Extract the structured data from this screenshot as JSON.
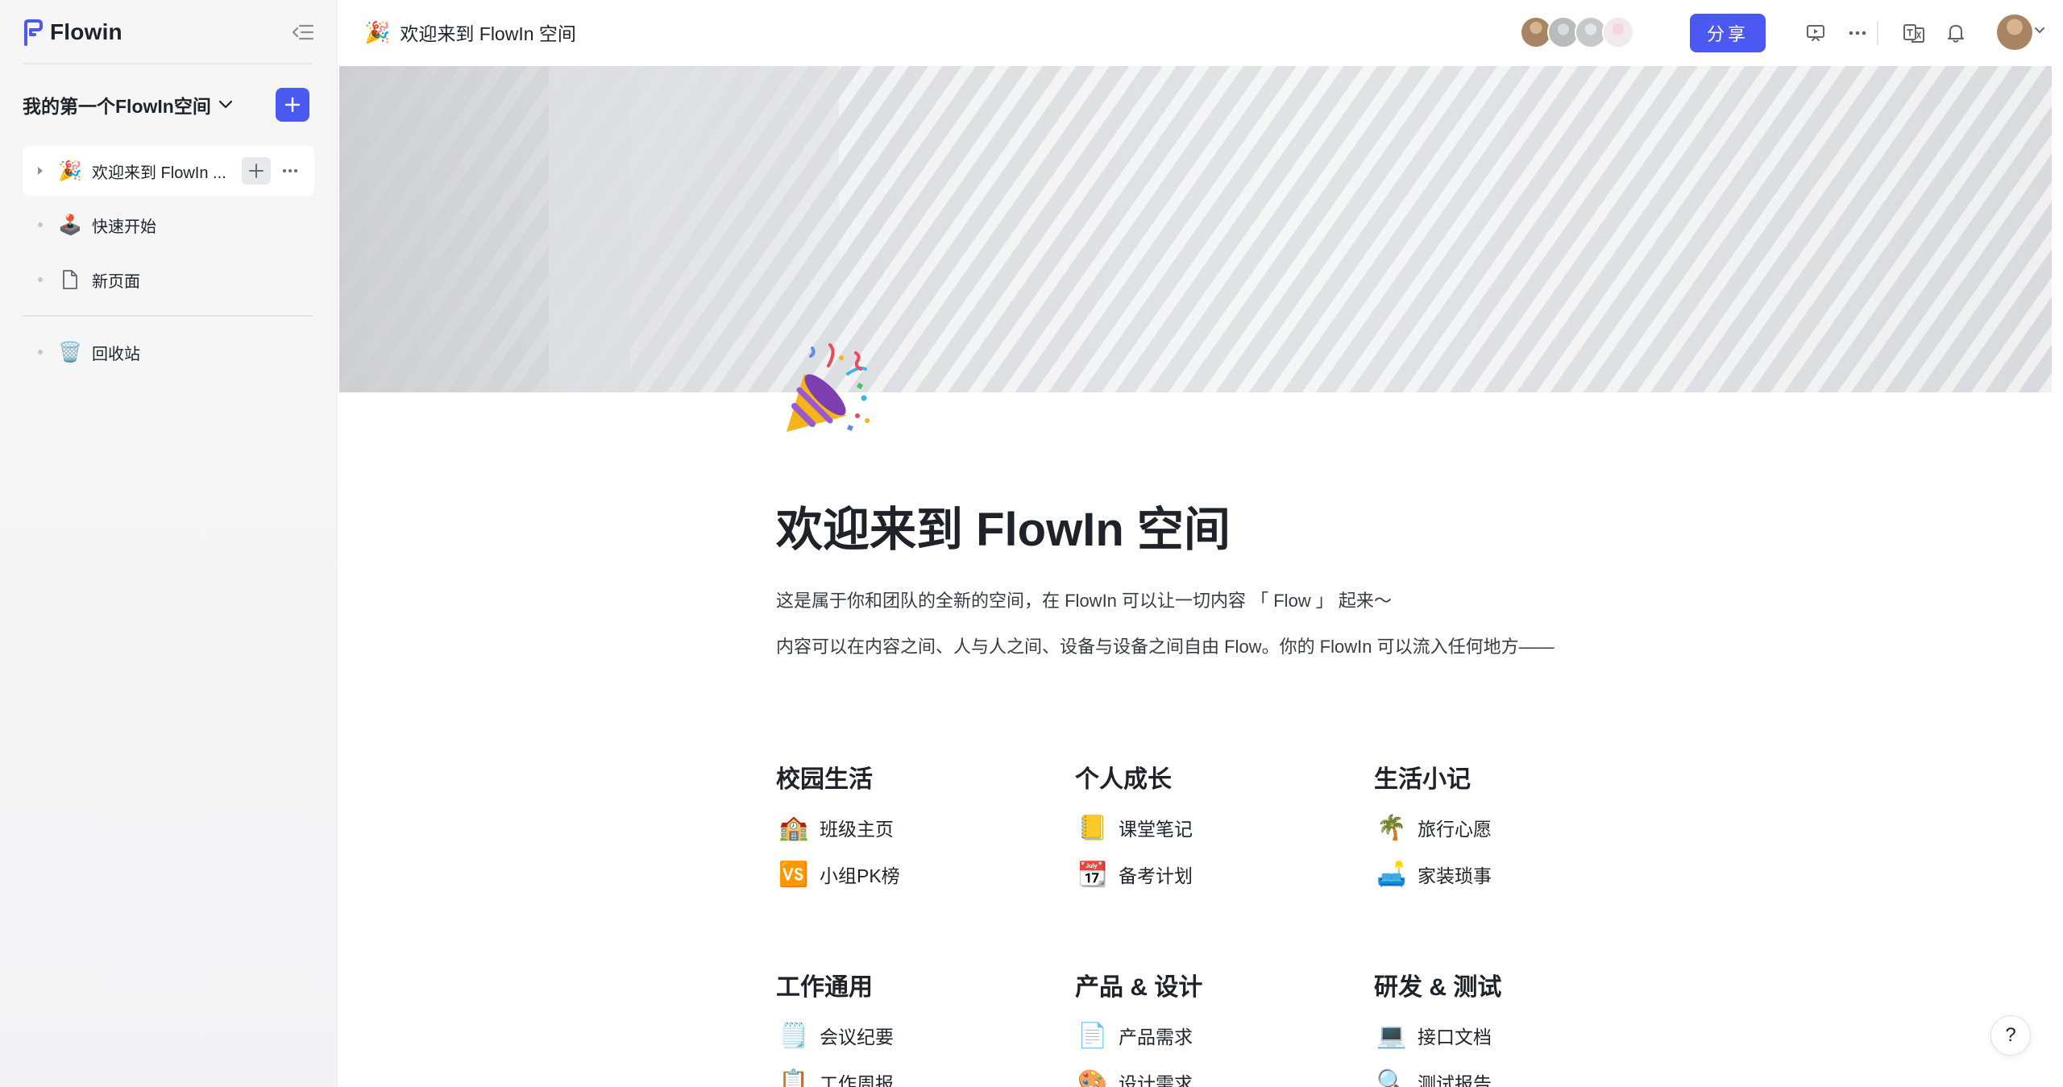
{
  "brand": {
    "name": "Flowin",
    "accent": "#4b59f2"
  },
  "sidebar": {
    "workspace_title": "我的第一个FlowIn空间",
    "pages": [
      {
        "label": "欢迎来到 FlowIn ...",
        "icon": "party-popper-icon",
        "emoji": "🎉",
        "active": true
      },
      {
        "label": "快速开始",
        "icon": "joystick-icon",
        "emoji": "🕹️"
      },
      {
        "label": "新页面",
        "icon": "page-icon"
      }
    ],
    "trash": {
      "label": "回收站",
      "icon": "trash-icon",
      "emoji": "🗑️"
    }
  },
  "topbar": {
    "breadcrumb": "欢迎来到 FlowIn 空间",
    "breadcrumb_emoji": "🎉",
    "share_label": "分享",
    "collaborators": [
      "#a88463",
      "#b9bbbd",
      "#c6c8ca",
      "#f1e9ec"
    ]
  },
  "doc": {
    "emoji": "🎉",
    "title": "欢迎来到 FlowIn 空间",
    "paragraphs": [
      "这是属于你和团队的全新的空间，在 FlowIn 可以让一切内容 「 Flow 」 起来～",
      "内容可以在内容之间、人与人之间、设备与设备之间自由 Flow。你的 FlowIn 可以流入任何地方——"
    ],
    "sections": [
      {
        "title": "校园生活",
        "items": [
          {
            "label": "班级主页",
            "emoji": "🏫"
          },
          {
            "label": "小组PK榜",
            "emoji": "🆚"
          }
        ]
      },
      {
        "title": "个人成长",
        "items": [
          {
            "label": "课堂笔记",
            "emoji": "📒"
          },
          {
            "label": "备考计划",
            "emoji": "📆"
          }
        ]
      },
      {
        "title": "生活小记",
        "items": [
          {
            "label": "旅行心愿",
            "emoji": "🌴"
          },
          {
            "label": "家装琐事",
            "emoji": "🛋️"
          }
        ]
      },
      {
        "title": "工作通用",
        "items": [
          {
            "label": "会议纪要",
            "emoji": "🗒️"
          },
          {
            "label": "工作周报",
            "emoji": "📋"
          }
        ]
      },
      {
        "title": "产品 & 设计",
        "items": [
          {
            "label": "产品需求",
            "emoji": "📄"
          },
          {
            "label": "设计需求",
            "emoji": "🎨"
          }
        ]
      },
      {
        "title": "研发 & 测试",
        "items": [
          {
            "label": "接口文档",
            "emoji": "💻"
          },
          {
            "label": "测试报告",
            "emoji": "🔍"
          }
        ]
      }
    ]
  },
  "help": {
    "label": "?"
  }
}
